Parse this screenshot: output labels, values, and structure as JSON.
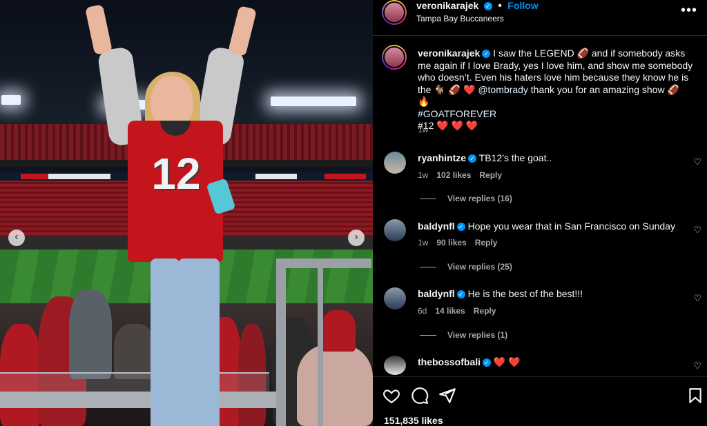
{
  "post_author": {
    "username": "veronikarajek",
    "follow_label": "Follow",
    "location": "Tampa Bay Buccaneers",
    "separator": "•"
  },
  "caption": {
    "username": "veronikarajek",
    "text_part1": " I saw the LEGEND 🏈 and if somebody asks me again if I love Brady, yes I love him, and show me somebody who doesn’t. Even his haters love him because they know he is the 🐐 🏈 ❤️ ",
    "mention": "@tombrady",
    "text_part2": " thank you for an amazing show 🏈 🔥",
    "hashtag": "#GOATFOREVER",
    "line3": "#12 ❤️ ❤️ ❤️",
    "time": "1w"
  },
  "photo": {
    "jersey_number": "12",
    "prev_icon": "‹",
    "next_icon": "›"
  },
  "comments": [
    {
      "username": "ryanhintze",
      "text": "TB12’s the goat..",
      "time": "1w",
      "likes": "102 likes",
      "reply": "Reply",
      "view_replies": "View replies (16)"
    },
    {
      "username": "baldynfl",
      "text": "Hope you wear that in San Francisco on Sunday",
      "time": "1w",
      "likes": "90 likes",
      "reply": "Reply",
      "view_replies": "View replies (25)"
    },
    {
      "username": "baldynfl",
      "text": "He is the best of the best!!!",
      "time": "6d",
      "likes": "14 likes",
      "reply": "Reply",
      "view_replies": "View replies (1)"
    },
    {
      "username": "thebossofbali",
      "text": "❤️ ❤️"
    }
  ],
  "footer": {
    "likes": "151,835 likes"
  },
  "icons": {
    "more": "more-options-icon",
    "like": "heart-icon",
    "comment": "comment-icon",
    "share": "share-icon",
    "save": "bookmark-icon",
    "verified": "verified-badge-icon"
  },
  "colors": {
    "accent": "#0095f6",
    "background": "#000000",
    "secondary_text": "#a8a8a8",
    "jersey_red": "#c4151c"
  }
}
